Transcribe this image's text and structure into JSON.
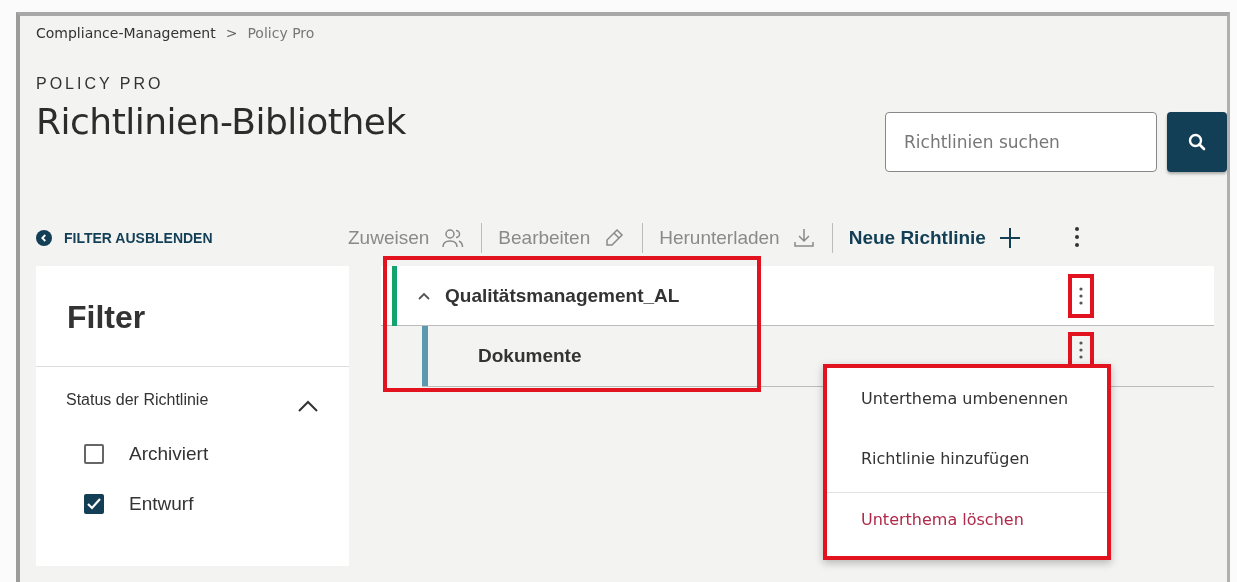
{
  "breadcrumb": [
    {
      "label": "Compliance-Management",
      "current": false
    },
    {
      "label": "Policy Pro",
      "current": true
    }
  ],
  "breadcrumb_separator": ">",
  "header": {
    "eyebrow": "POLICY PRO",
    "title": "Richtlinien-Bibliothek"
  },
  "search": {
    "placeholder": "Richtlinien suchen"
  },
  "filter_toggle": "FILTER AUSBLENDEN",
  "toolbar": [
    {
      "label": "Zuweisen",
      "kind": "assign",
      "disabled": true
    },
    {
      "label": "Bearbeiten",
      "kind": "edit",
      "disabled": true
    },
    {
      "label": "Herunterladen",
      "kind": "download",
      "disabled": true
    },
    {
      "label": "Neue Richtlinie",
      "kind": "add",
      "disabled": false
    }
  ],
  "filter": {
    "title": "Filter",
    "section": {
      "label": "Status der Richtlinie",
      "expanded": true,
      "options": [
        {
          "label": "Archiviert",
          "checked": false
        },
        {
          "label": "Entwurf",
          "checked": true
        }
      ]
    }
  },
  "tree": {
    "highlighted": true,
    "rows": [
      {
        "label": "Qualitätsmanagement_AL",
        "expanded": true,
        "menu_highlighted": true,
        "children": [
          {
            "label": "Dokumente",
            "menu_highlighted": true
          }
        ]
      }
    ]
  },
  "context_menu": {
    "highlighted": true,
    "items": [
      {
        "label": "Unterthema umbenennen",
        "kind": "normal"
      },
      {
        "label": "Richtlinie hinzufügen",
        "kind": "normal"
      },
      {
        "label": "Unterthema löschen",
        "kind": "danger"
      }
    ]
  }
}
